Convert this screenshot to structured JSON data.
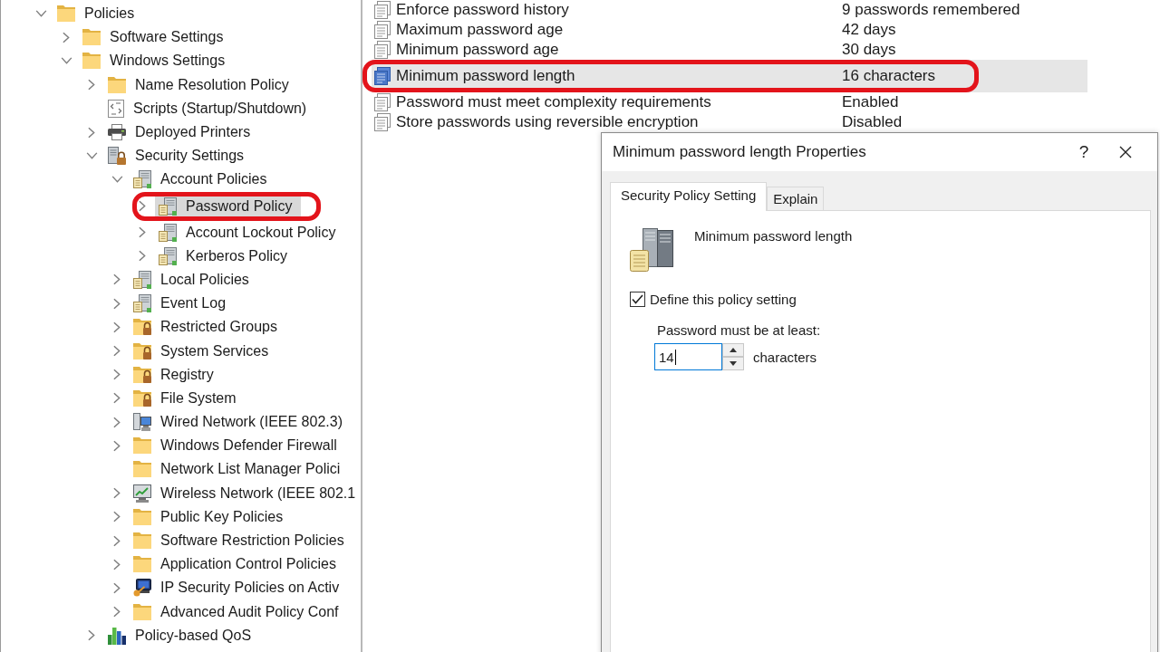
{
  "tree": [
    {
      "label": "Policies",
      "kind": "folder",
      "expanded": true,
      "selected": false,
      "circled": false,
      "children": [
        {
          "label": "Software Settings",
          "kind": "folder",
          "expanded": false,
          "selected": false,
          "circled": false
        },
        {
          "label": "Windows Settings",
          "kind": "folder",
          "expanded": true,
          "selected": false,
          "circled": false,
          "children": [
            {
              "label": "Name Resolution Policy",
              "kind": "folder",
              "expanded": false,
              "selected": false,
              "circled": false
            },
            {
              "label": "Scripts (Startup/Shutdown)",
              "kind": "script",
              "selected": false,
              "circled": false
            },
            {
              "label": "Deployed Printers",
              "kind": "printer",
              "expanded": false,
              "selected": false,
              "circled": false
            },
            {
              "label": "Security Settings",
              "kind": "security",
              "expanded": true,
              "selected": false,
              "circled": false,
              "children": [
                {
                  "label": "Account Policies",
                  "kind": "policy",
                  "expanded": true,
                  "selected": false,
                  "circled": false,
                  "children": [
                    {
                      "label": "Password Policy",
                      "kind": "policy",
                      "expanded": false,
                      "selected": true,
                      "circled": true
                    },
                    {
                      "label": "Account Lockout Policy",
                      "kind": "policy",
                      "expanded": false,
                      "selected": false,
                      "circled": false
                    },
                    {
                      "label": "Kerberos Policy",
                      "kind": "policy",
                      "expanded": false,
                      "selected": false,
                      "circled": false
                    }
                  ]
                },
                {
                  "label": "Local Policies",
                  "kind": "policy",
                  "expanded": false,
                  "selected": false,
                  "circled": false
                },
                {
                  "label": "Event Log",
                  "kind": "policy",
                  "expanded": false,
                  "selected": false,
                  "circled": false
                },
                {
                  "label": "Restricted Groups",
                  "kind": "locked-folder",
                  "expanded": false,
                  "selected": false,
                  "circled": false
                },
                {
                  "label": "System Services",
                  "kind": "locked-folder",
                  "expanded": false,
                  "selected": false,
                  "circled": false
                },
                {
                  "label": "Registry",
                  "kind": "locked-folder",
                  "expanded": false,
                  "selected": false,
                  "circled": false
                },
                {
                  "label": "File System",
                  "kind": "locked-folder",
                  "expanded": false,
                  "selected": false,
                  "circled": false
                },
                {
                  "label": "Wired Network (IEEE 802.3)",
                  "kind": "wired-network",
                  "expanded": false,
                  "selected": false,
                  "circled": false
                },
                {
                  "label": "Windows Defender Firewall",
                  "kind": "folder",
                  "expanded": false,
                  "selected": false,
                  "circled": false
                },
                {
                  "label": "Network List Manager Polici",
                  "kind": "folder",
                  "selected": false,
                  "circled": false
                },
                {
                  "label": "Wireless Network (IEEE 802.1",
                  "kind": "wireless-network",
                  "expanded": false,
                  "selected": false,
                  "circled": false
                },
                {
                  "label": "Public Key Policies",
                  "kind": "folder",
                  "expanded": false,
                  "selected": false,
                  "circled": false
                },
                {
                  "label": "Software Restriction Policies",
                  "kind": "folder",
                  "expanded": false,
                  "selected": false,
                  "circled": false
                },
                {
                  "label": "Application Control Policies",
                  "kind": "folder",
                  "expanded": false,
                  "selected": false,
                  "circled": false
                },
                {
                  "label": "IP Security Policies on Activ",
                  "kind": "ip-security",
                  "expanded": false,
                  "selected": false,
                  "circled": false
                },
                {
                  "label": "Advanced Audit Policy Conf",
                  "kind": "folder",
                  "expanded": false,
                  "selected": false,
                  "circled": false
                }
              ]
            },
            {
              "label": "Policy-based QoS",
              "kind": "qos",
              "expanded": false,
              "selected": false,
              "circled": false
            }
          ]
        }
      ]
    }
  ],
  "policy_list": {
    "rows": [
      {
        "column_1": "Enforce password history",
        "column_2": "9 passwords remembered",
        "selected": false,
        "circled": false
      },
      {
        "column_1": "Maximum password age",
        "column_2": "42 days",
        "selected": false,
        "circled": false
      },
      {
        "column_1": "Minimum password age",
        "column_2": "30 days",
        "selected": false,
        "circled": false
      },
      {
        "column_1": "Minimum password length",
        "column_2": "16 characters",
        "selected": true,
        "circled": true
      },
      {
        "column_1": "Password must meet complexity requirements",
        "column_2": "Enabled",
        "selected": false,
        "circled": false
      },
      {
        "column_1": "Store passwords using reversible encryption",
        "column_2": "Disabled",
        "selected": false,
        "circled": false
      }
    ]
  },
  "dialog": {
    "title": "Minimum password length Properties",
    "help_button": "?",
    "tabs": [
      {
        "label": "Security Policy Setting",
        "selected": true
      },
      {
        "label": "Explain",
        "selected": false
      }
    ],
    "policy_name": "Minimum password length",
    "define_checkbox": {
      "label": "Define this policy setting",
      "checked": true
    },
    "length_label": "Password must be at least:",
    "length_field": {
      "value": "14",
      "focused": true
    },
    "length_unit": "characters"
  }
}
